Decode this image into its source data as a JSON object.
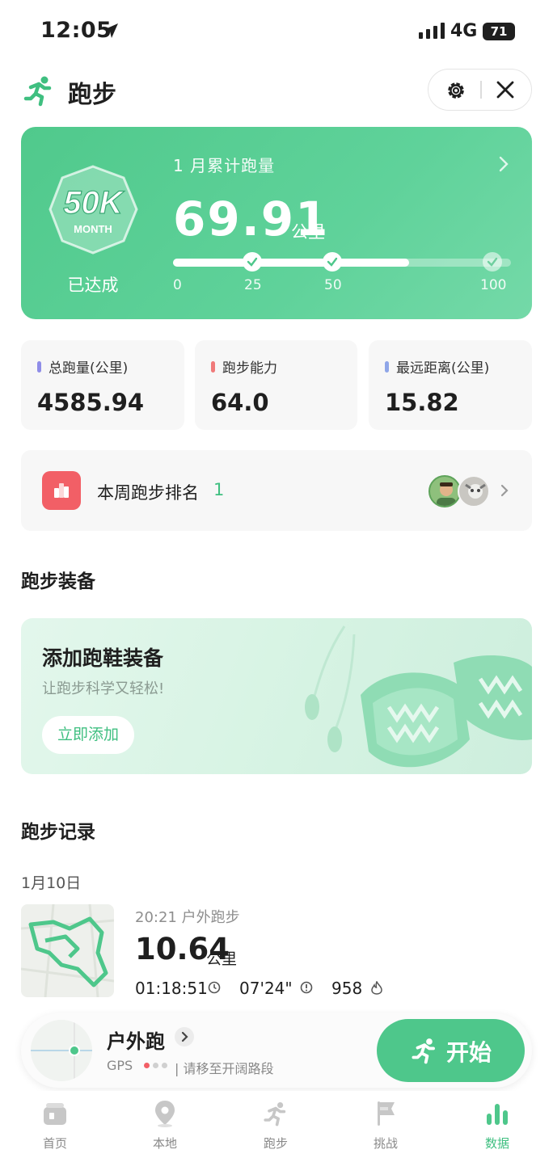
{
  "status_bar": {
    "time": "12:05",
    "network": "4G",
    "battery": "71"
  },
  "header": {
    "title": "跑步"
  },
  "monthly": {
    "badge_big": "50K",
    "badge_small": "MONTH",
    "badge_status": "已达成",
    "label": "1 月累计跑量",
    "value": "69.91",
    "unit": "公里",
    "progress": 0.6991,
    "ticks": [
      "0",
      "25",
      "50",
      "100"
    ]
  },
  "stats": [
    {
      "label": "总跑量(公里)",
      "value": "4585.94",
      "color": "#8f8de8"
    },
    {
      "label": "跑步能力",
      "value": "64.0",
      "color": "#f07a7a"
    },
    {
      "label": "最远距离(公里)",
      "value": "15.82",
      "color": "#8fa6e8"
    }
  ],
  "ranking": {
    "label": "本周跑步排名",
    "value": "1"
  },
  "equipment": {
    "section_title": "跑步装备",
    "title": "添加跑鞋装备",
    "subtitle": "让跑步科学又轻松!",
    "button": "立即添加"
  },
  "records": {
    "section_title": "跑步记录",
    "date": "1月10日",
    "item": {
      "time_type": "20:21 户外跑步",
      "distance": "10.64",
      "unit": "公里",
      "duration": "01:18:51",
      "pace": "07'24\"",
      "calories": "958"
    }
  },
  "run_card": {
    "mode": "户外跑",
    "gps_label": "GPS",
    "gps_hint": "| 请移至开阔路段",
    "start": "开始"
  },
  "tabs": [
    {
      "label": "首页",
      "icon": "home-icon"
    },
    {
      "label": "本地",
      "icon": "location-pin-icon"
    },
    {
      "label": "跑步",
      "icon": "runner-icon"
    },
    {
      "label": "挑战",
      "icon": "flag-icon"
    },
    {
      "label": "数据",
      "icon": "bar-chart-icon"
    }
  ],
  "colors": {
    "accent": "#4ec78b",
    "rank_icon": "#f25f66"
  }
}
